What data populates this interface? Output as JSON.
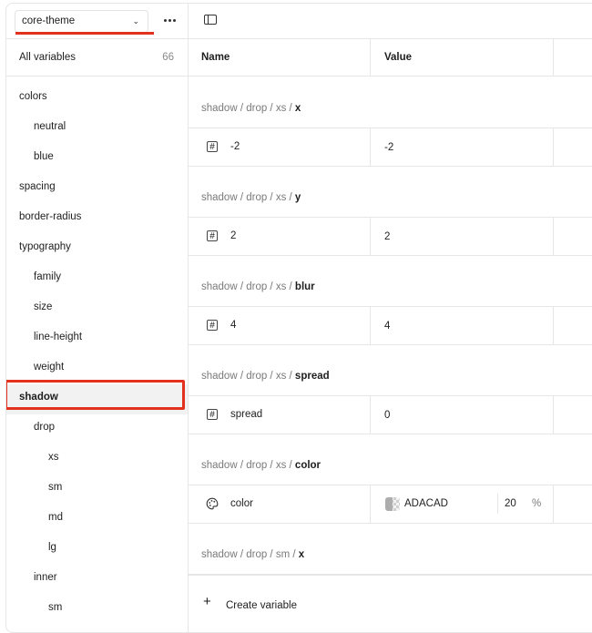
{
  "sidebar": {
    "theme_selector": {
      "value": "core-theme"
    },
    "all_variables": {
      "label": "All variables",
      "count": "66"
    },
    "groups": [
      {
        "label": "colors",
        "level": 0
      },
      {
        "label": "neutral",
        "level": 1
      },
      {
        "label": "blue",
        "level": 1
      },
      {
        "label": "spacing",
        "level": 0
      },
      {
        "label": "border-radius",
        "level": 0
      },
      {
        "label": "typography",
        "level": 0
      },
      {
        "label": "family",
        "level": 1
      },
      {
        "label": "size",
        "level": 1
      },
      {
        "label": "line-height",
        "level": 1
      },
      {
        "label": "weight",
        "level": 1
      },
      {
        "label": "shadow",
        "level": 0,
        "selected": true
      },
      {
        "label": "drop",
        "level": 1
      },
      {
        "label": "xs",
        "level": 2
      },
      {
        "label": "sm",
        "level": 2
      },
      {
        "label": "md",
        "level": 2
      },
      {
        "label": "lg",
        "level": 2
      },
      {
        "label": "inner",
        "level": 1
      },
      {
        "label": "sm",
        "level": 2
      }
    ]
  },
  "table": {
    "headers": {
      "name": "Name",
      "value": "Value"
    },
    "rows": [
      {
        "path_prefix": "shadow / drop / xs / ",
        "path_last": "x",
        "icon": "number-icon",
        "name": "-2",
        "value": "-2"
      },
      {
        "path_prefix": "shadow / drop / xs / ",
        "path_last": "y",
        "icon": "number-icon",
        "name": "2",
        "value": "2"
      },
      {
        "path_prefix": "shadow / drop / xs / ",
        "path_last": "blur",
        "icon": "number-icon",
        "name": "4",
        "value": "4"
      },
      {
        "path_prefix": "shadow / drop / xs / ",
        "path_last": "spread",
        "icon": "number-icon",
        "name": "spread",
        "value": "0"
      },
      {
        "path_prefix": "shadow / drop / xs / ",
        "path_last": "color",
        "icon": "palette-icon",
        "name": "color",
        "value": "ADACAD",
        "opacity": "20",
        "opacity_unit": "%"
      },
      {
        "path_prefix": "shadow / drop / sm / ",
        "path_last": "x"
      }
    ]
  },
  "footer": {
    "create_label": "Create variable"
  },
  "colors": {
    "accent_annotation": "#e2311d",
    "swatch": "#adadad"
  }
}
